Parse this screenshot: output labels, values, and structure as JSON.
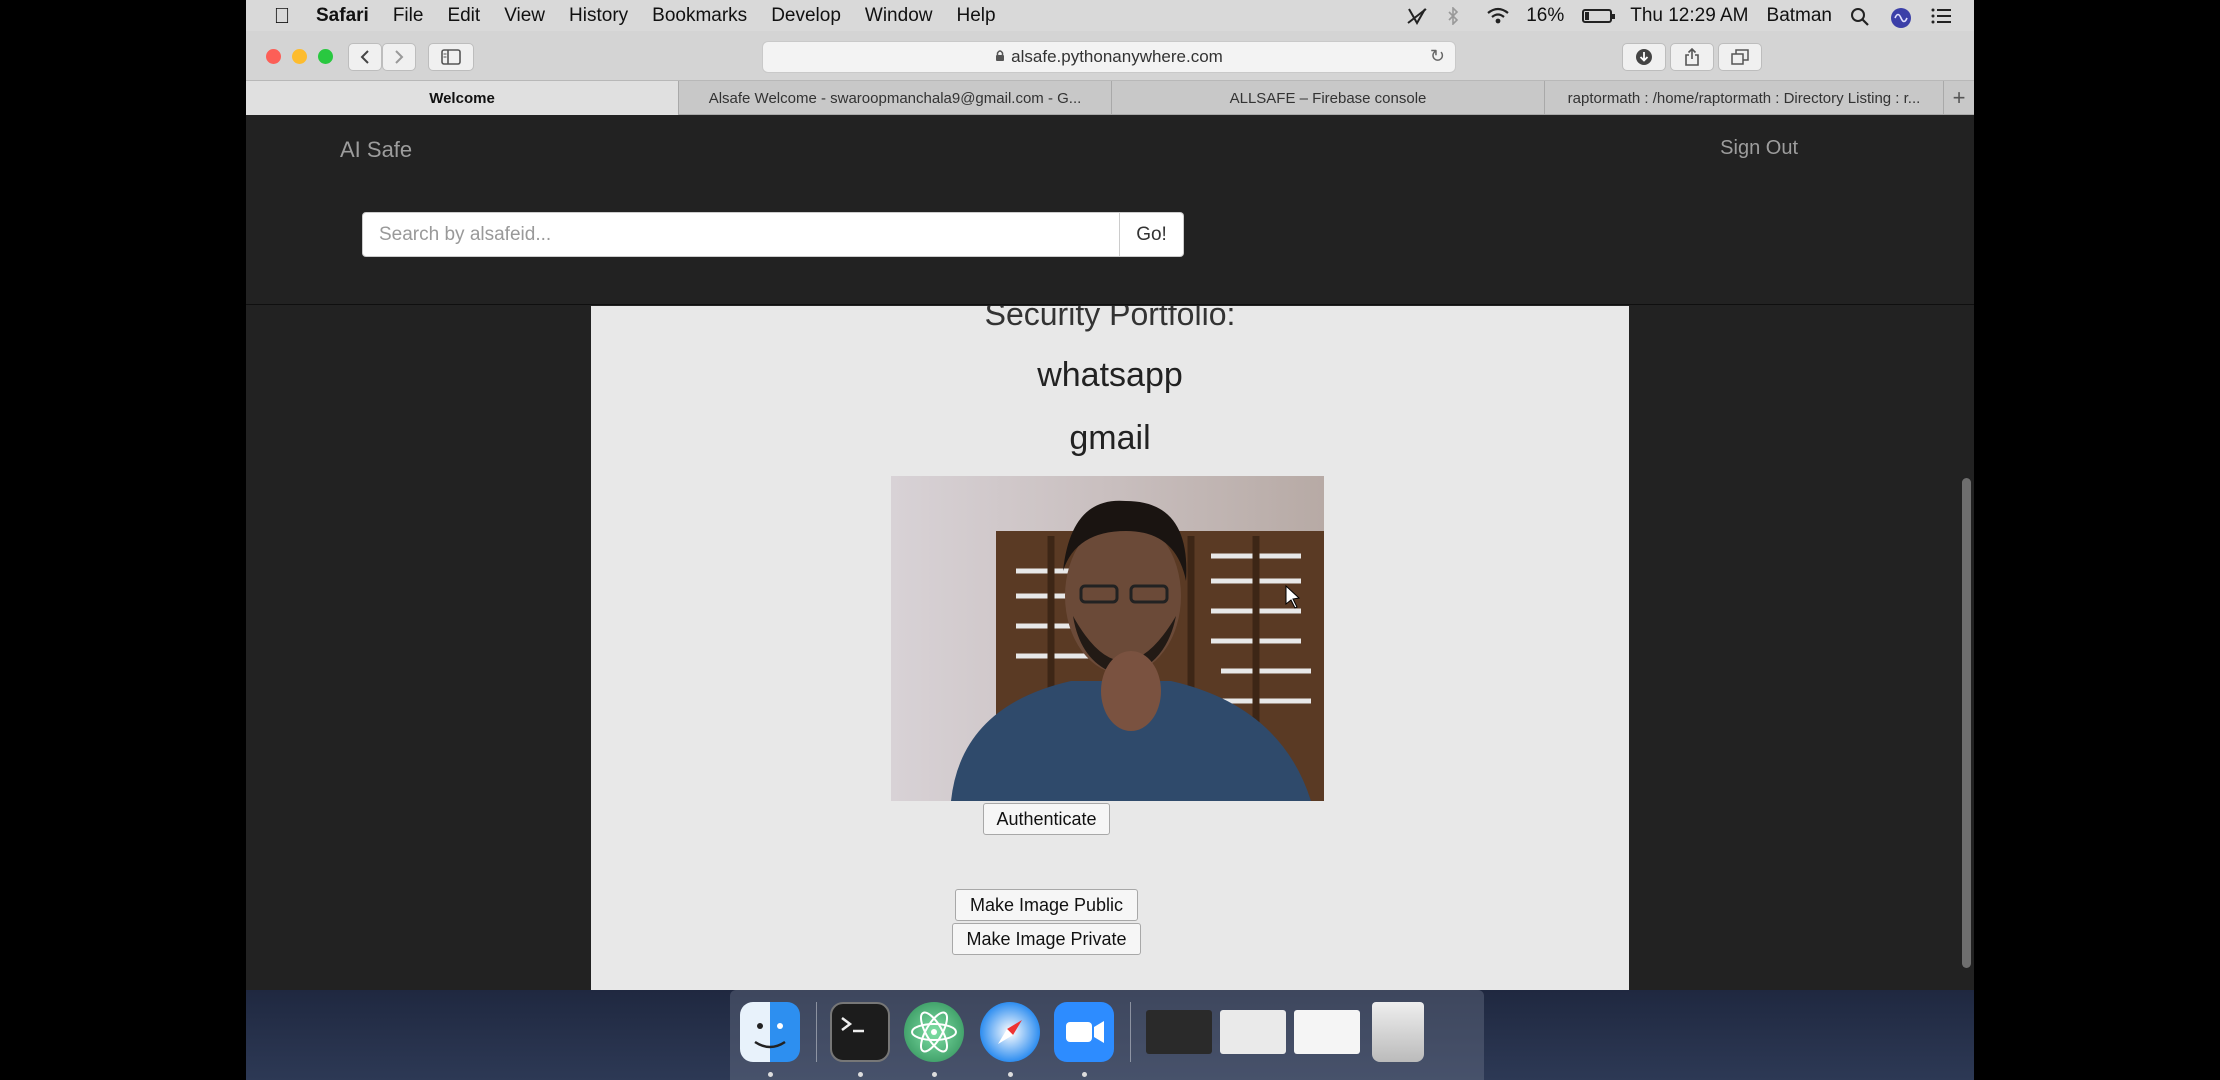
{
  "menubar": {
    "apple_icon": "apple-logo-icon",
    "items": [
      "Safari",
      "File",
      "Edit",
      "View",
      "History",
      "Bookmarks",
      "Develop",
      "Window",
      "Help"
    ],
    "battery_percent": "16%",
    "battery_level": 0.16,
    "clock": "Thu 12:29 AM",
    "user": "Batman"
  },
  "browser": {
    "url": "alsafe.pythonanywhere.com",
    "tabs": [
      {
        "label": "Welcome",
        "active": true
      },
      {
        "label": "Alsafe Welcome - swaroopmanchala9@gmail.com - G...",
        "active": false
      },
      {
        "label": "ALLSAFE – Firebase console",
        "active": false
      },
      {
        "label": "raptormath : /home/raptormath : Directory Listing : r...",
        "active": false
      }
    ],
    "new_tab_label": "+"
  },
  "page": {
    "brand": "AI Safe",
    "signout": "Sign Out",
    "search_placeholder": "Search by alsafeid...",
    "go_label": "Go!",
    "portfolio_title": "Security Portfolio:",
    "portfolio_items": [
      "whatsapp",
      "gmail"
    ],
    "authenticate_label": "Authenticate",
    "make_public_label": "Make Image Public",
    "make_private_label": "Make Image Private"
  },
  "dock": {
    "apps": [
      "finder-icon",
      "terminal-icon",
      "atom-icon",
      "safari-icon",
      "zoom-icon"
    ],
    "windows": [
      "terminal-window-thumb",
      "safari-window-thumb",
      "zoom-window-thumb"
    ],
    "trash": "trash-icon"
  }
}
